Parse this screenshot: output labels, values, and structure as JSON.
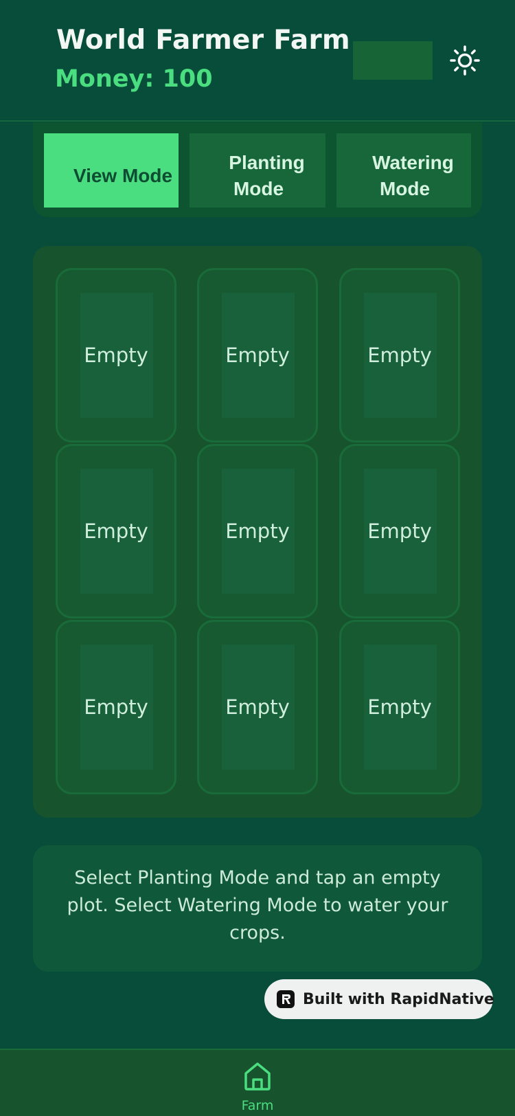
{
  "header": {
    "title": "World Farmer Farm",
    "money_label": "Money:",
    "money_value": "100"
  },
  "modes": [
    {
      "label": "View Mode",
      "active": true
    },
    {
      "label": "Planting Mode",
      "active": false
    },
    {
      "label": "Watering Mode",
      "active": false
    }
  ],
  "plots": [
    {
      "label": "Empty"
    },
    {
      "label": "Empty"
    },
    {
      "label": "Empty"
    },
    {
      "label": "Empty"
    },
    {
      "label": "Empty"
    },
    {
      "label": "Empty"
    },
    {
      "label": "Empty"
    },
    {
      "label": "Empty"
    },
    {
      "label": "Empty"
    }
  ],
  "instructions": "Select Planting Mode and tap an empty plot. Select Watering Mode to water your crops.",
  "badge": {
    "text": "Built with RapidNative"
  },
  "tabbar": {
    "tabs": [
      {
        "label": "Farm",
        "icon": "home-icon",
        "active": true
      }
    ]
  },
  "colors": {
    "background": "#074d3a",
    "accent": "#4ade80",
    "panel": "#17542e"
  }
}
